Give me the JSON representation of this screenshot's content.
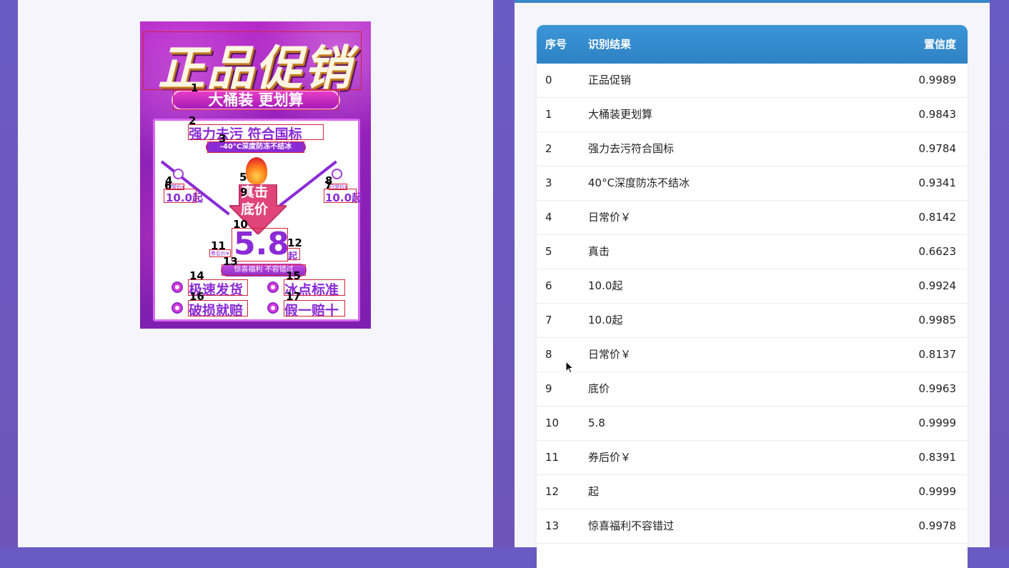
{
  "poster": {
    "title": "正品促销",
    "subtitle": "大桶装 更划算",
    "tagline": "强力去污 符合国标",
    "sub_tagline": "-40°C深度防冻不结冰",
    "left_label": "日常价¥",
    "left_price": "10.0起",
    "right_label": "日常价¥",
    "right_price": "10.0起",
    "arrow_top": "真击",
    "arrow_bottom": "底价",
    "coupon_label": "券后价¥",
    "big_price": "5.8",
    "price_suffix": "起",
    "promo": "惊喜福利 不容错过",
    "features": [
      "极速发货",
      "冰点标准",
      "破损就赔",
      "假一赔十"
    ],
    "box_numbers": [
      "1",
      "2",
      "3",
      "4",
      "5",
      "6",
      "7",
      "8",
      "9",
      "10",
      "11",
      "12",
      "13",
      "14",
      "15",
      "16",
      "17"
    ]
  },
  "table": {
    "headers": {
      "index": "序号",
      "text": "识别结果",
      "confidence": "置信度"
    },
    "rows": [
      {
        "index": "0",
        "text": "正品促销",
        "confidence": "0.9989"
      },
      {
        "index": "1",
        "text": "大桶装更划算",
        "confidence": "0.9843"
      },
      {
        "index": "2",
        "text": "强力去污符合国标",
        "confidence": "0.9784"
      },
      {
        "index": "3",
        "text": "40°C深度防冻不结冰",
        "confidence": "0.9341"
      },
      {
        "index": "4",
        "text": "日常价￥",
        "confidence": "0.8142"
      },
      {
        "index": "5",
        "text": "真击",
        "confidence": "0.6623"
      },
      {
        "index": "6",
        "text": "10.0起",
        "confidence": "0.9924"
      },
      {
        "index": "7",
        "text": "10.0起",
        "confidence": "0.9985"
      },
      {
        "index": "8",
        "text": "日常价￥",
        "confidence": "0.8137"
      },
      {
        "index": "9",
        "text": "底价",
        "confidence": "0.9963"
      },
      {
        "index": "10",
        "text": "5.8",
        "confidence": "0.9999"
      },
      {
        "index": "11",
        "text": "券后价￥",
        "confidence": "0.8391"
      },
      {
        "index": "12",
        "text": "起",
        "confidence": "0.9999"
      },
      {
        "index": "13",
        "text": "惊喜福利不容错过",
        "confidence": "0.9978"
      }
    ]
  },
  "colors": {
    "header_blue": "#3a95d6",
    "box_red": "#d4233a",
    "poster_purple": "#9121b9"
  }
}
